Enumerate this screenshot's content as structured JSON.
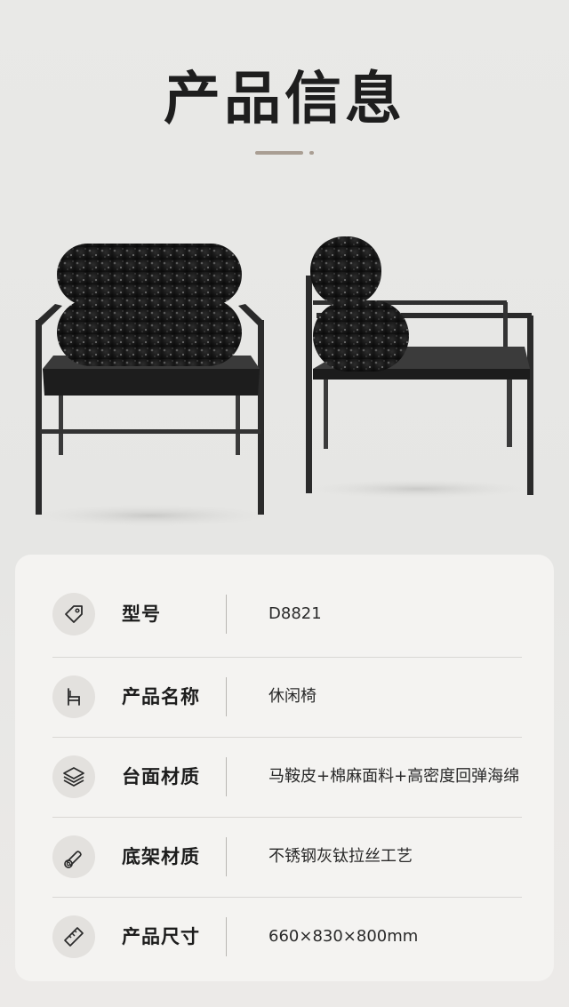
{
  "header": {
    "title": "产品信息"
  },
  "product_image": {
    "subject": "chair-photo"
  },
  "specs": [
    {
      "label": "型号",
      "value": "D8821",
      "icon": "tag-icon"
    },
    {
      "label": "产品名称",
      "value": "休闲椅",
      "icon": "chair-icon"
    },
    {
      "label": "台面材质",
      "value": "马鞍皮+棉麻面料+高密度回弹海绵",
      "icon": "layers-icon"
    },
    {
      "label": "底架材质",
      "value": "不锈钢灰钛拉丝工艺",
      "icon": "pipe-icon"
    },
    {
      "label": "产品尺寸",
      "value": "660×830×800mm",
      "icon": "ruler-icon"
    }
  ],
  "colors": {
    "accent": "#a99e93",
    "card_bg": "#f4f3f1",
    "icon_bg": "#e3e1de",
    "text": "#1c1c1c"
  }
}
